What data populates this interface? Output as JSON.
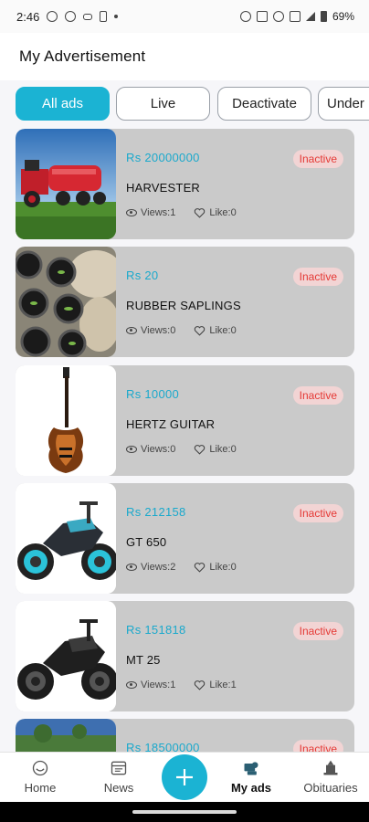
{
  "status_bar": {
    "time": "2:46",
    "battery": "69%"
  },
  "header": {
    "title": "My Advertisement"
  },
  "filters": [
    {
      "label": "All ads",
      "active": true
    },
    {
      "label": "Live",
      "active": false
    },
    {
      "label": "Deactivate",
      "active": false
    },
    {
      "label": "Under",
      "active": false
    }
  ],
  "ads": [
    {
      "price": "Rs 20000000",
      "status": "Inactive",
      "name": "HARVESTER",
      "views": "Views:1",
      "likes": "Like:0",
      "image": "harvester-image"
    },
    {
      "price": "Rs 20",
      "status": "Inactive",
      "name": "RUBBER SAPLINGS",
      "views": "Views:0",
      "likes": "Like:0",
      "image": "saplings-image"
    },
    {
      "price": "Rs 10000",
      "status": "Inactive",
      "name": "HERTZ GUITAR",
      "views": "Views:0",
      "likes": "Like:0",
      "image": "guitar-image"
    },
    {
      "price": "Rs 212158",
      "status": "Inactive",
      "name": "GT 650",
      "views": "Views:2",
      "likes": "Like:0",
      "image": "motorcycle-image"
    },
    {
      "price": "Rs 151818",
      "status": "Inactive",
      "name": "MT 25",
      "views": "Views:1",
      "likes": "Like:1",
      "image": "motorcycle-image"
    },
    {
      "price": "Rs 18500000",
      "status": "Inactive",
      "name": "",
      "views": "",
      "likes": "",
      "image": "building-image"
    }
  ],
  "bottom_nav": {
    "items": [
      {
        "label": "Home",
        "icon": "home-icon",
        "active": false
      },
      {
        "label": "News",
        "icon": "news-icon",
        "active": false
      },
      {
        "label": "My ads",
        "icon": "my-ads-icon",
        "active": true
      },
      {
        "label": "Obituaries",
        "icon": "obituaries-icon",
        "active": false
      }
    ],
    "fab_icon": "plus-icon"
  },
  "colors": {
    "accent": "#1bb3d3",
    "inactive_text": "#e53935",
    "inactive_bg": "#f2d4d4",
    "card_bg": "#cacaca"
  }
}
